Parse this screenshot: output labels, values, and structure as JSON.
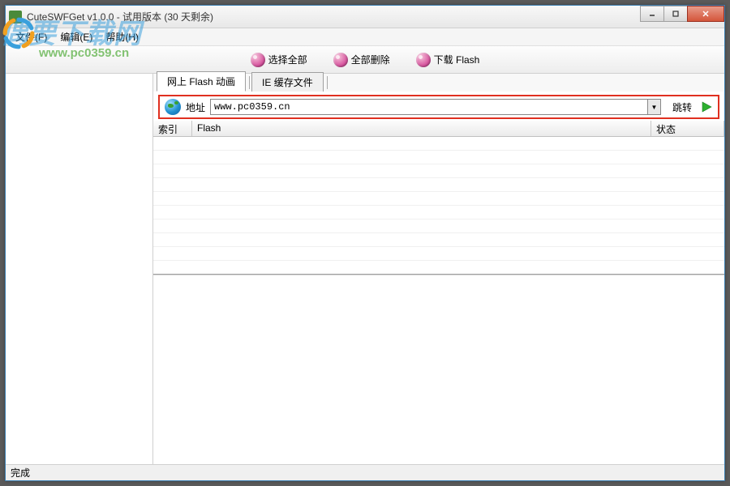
{
  "window": {
    "title": "CuteSWFGet v1.0.0 - 试用版本 (30 天剩余)"
  },
  "menubar": {
    "file": "文件(F)",
    "edit": "编辑(E)",
    "help": "帮助(H)"
  },
  "toolbar": {
    "select_all": "选择全部",
    "delete_all": "全部删除",
    "download_flash": "下载 Flash"
  },
  "tabs": {
    "web_flash": "网上 Flash 动画",
    "ie_cache": "IE 缓存文件"
  },
  "address": {
    "label": "地址",
    "value": "www.pc0359.cn",
    "go_label": "跳转"
  },
  "table": {
    "col_index": "索引",
    "col_flash": "Flash",
    "col_status": "状态"
  },
  "statusbar": {
    "text": "完成"
  },
  "watermark": {
    "text": "偶要下载网",
    "url": "www.pc0359.cn"
  }
}
